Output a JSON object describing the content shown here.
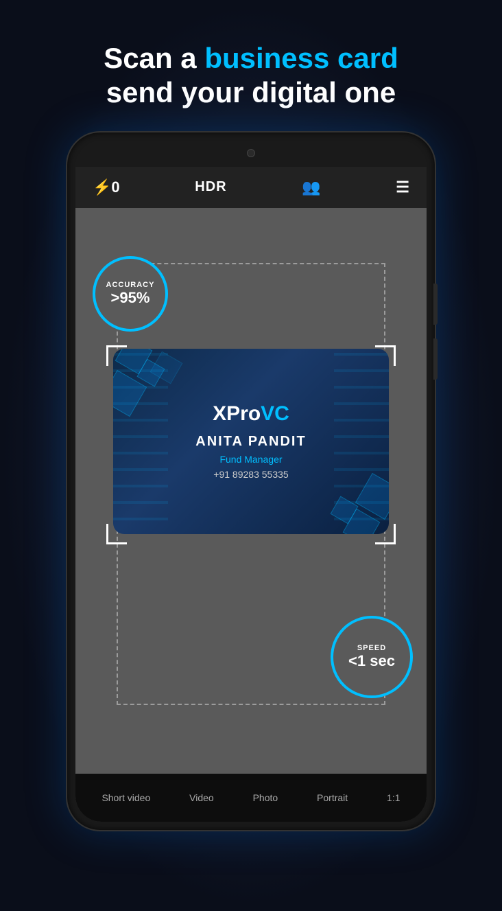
{
  "headline": {
    "line1": "Scan a ",
    "highlight": "business card",
    "line2": "send your digital one"
  },
  "camera": {
    "flash_label": "⚡0",
    "hdr_label": "HDR",
    "people_icon": "👥",
    "menu_icon": "☰"
  },
  "accuracy": {
    "label": "ACCURACY",
    "value": ">95%"
  },
  "speed": {
    "label": "SPEED",
    "value": "<1 sec"
  },
  "business_card": {
    "brand_prefix": "XPro",
    "brand_suffix": "VC",
    "name": "ANITA PANDIT",
    "title": "Fund Manager",
    "phone": "+91 89283 55335"
  },
  "modes": [
    {
      "label": "Short video",
      "active": false
    },
    {
      "label": "Video",
      "active": false
    },
    {
      "label": "Photo",
      "active": false
    },
    {
      "label": "Portrait",
      "active": false
    },
    {
      "label": "1:1",
      "active": false
    }
  ],
  "colors": {
    "accent": "#00bfff",
    "bg_dark": "#0a0e1a",
    "card_bg": "#0d2a4a"
  }
}
